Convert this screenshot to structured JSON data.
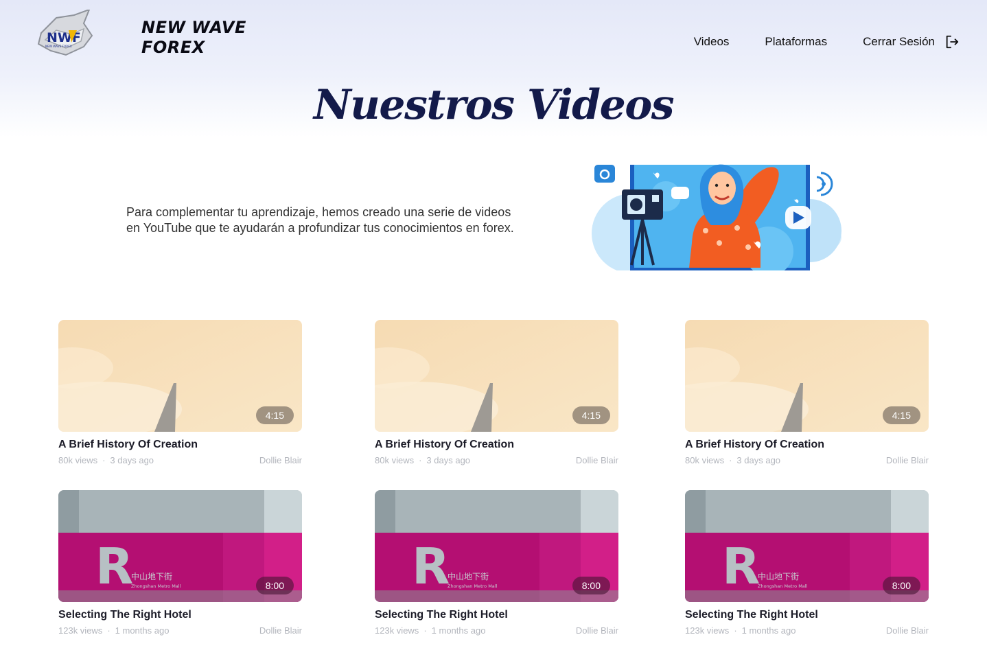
{
  "brand": {
    "line1": "NEW WAVE",
    "line2": "FOREX",
    "logo_text": "NWF",
    "logo_subtext": "NEW WAVE FOREX"
  },
  "nav": {
    "videos": "Videos",
    "platforms": "Plataformas",
    "logout": "Cerrar Sesión"
  },
  "page": {
    "title": "Nuestros Videos",
    "intro_line1": "Para complementar tu aprendizaje, hemos creado una serie de videos",
    "intro_line2": "en YouTube que te ayudarán a profundizar tus conocimientos en forex."
  },
  "videos": [
    {
      "title": "A Brief History Of Creation",
      "duration": "4:15",
      "views": "80k views",
      "age": "3 days ago",
      "author": "Dollie Blair",
      "thumb": "peach-sky"
    },
    {
      "title": "A Brief History Of Creation",
      "duration": "4:15",
      "views": "80k views",
      "age": "3 days ago",
      "author": "Dollie Blair",
      "thumb": "peach-sky"
    },
    {
      "title": "A Brief History Of Creation",
      "duration": "4:15",
      "views": "80k views",
      "age": "3 days ago",
      "author": "Dollie Blair",
      "thumb": "peach-sky"
    },
    {
      "title": "Selecting The Right Hotel",
      "duration": "8:00",
      "views": "123k views",
      "age": "1 months ago",
      "author": "Dollie Blair",
      "thumb": "pink-metro"
    },
    {
      "title": "Selecting The Right Hotel",
      "duration": "8:00",
      "views": "123k views",
      "age": "1 months ago",
      "author": "Dollie Blair",
      "thumb": "pink-metro"
    },
    {
      "title": "Selecting The Right Hotel",
      "duration": "8:00",
      "views": "123k views",
      "age": "1 months ago",
      "author": "Dollie Blair",
      "thumb": "pink-metro"
    }
  ],
  "thumb_signage": {
    "letter": "R",
    "cn": "中山地下街",
    "en": "Zhongshan Metro Mall"
  },
  "colors": {
    "title": "#131a4a",
    "meta": "#b3b6bd",
    "pink": "#b40f72",
    "peach": "#f7ddb8"
  }
}
